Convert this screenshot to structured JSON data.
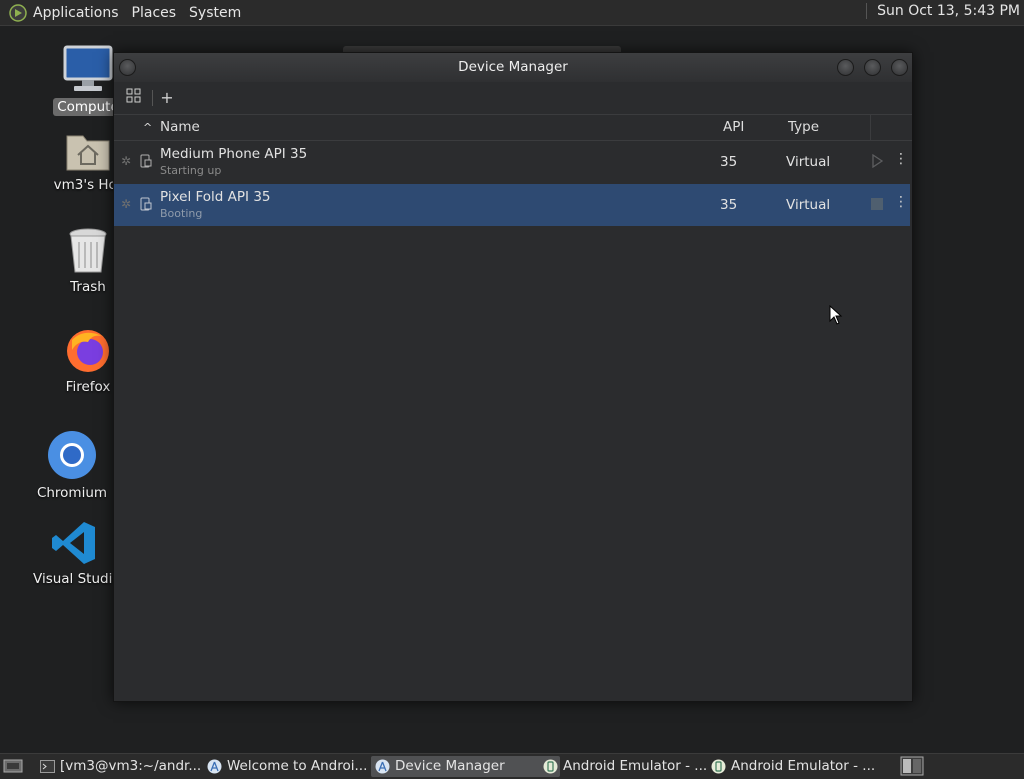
{
  "top_panel": {
    "menus": [
      "Applications",
      "Places",
      "System"
    ],
    "clock": "Sun Oct 13,  5:43 PM"
  },
  "desktop": {
    "icons": [
      {
        "label": "Compute",
        "icon": "computer-icon"
      },
      {
        "label": "vm3's Hor",
        "icon": "home-folder-icon"
      },
      {
        "label": "Trash",
        "icon": "trash-icon"
      },
      {
        "label": "Firefox",
        "icon": "firefox-icon"
      },
      {
        "label": "Chromium",
        "icon": "chromium-icon"
      },
      {
        "label": "Visual Studio Cc",
        "icon": "vscode-icon"
      }
    ]
  },
  "window": {
    "title": "Device Manager",
    "toolbar": {
      "add_label": "+"
    },
    "columns": {
      "name": "Name",
      "api": "API",
      "type": "Type"
    },
    "devices": [
      {
        "name": "Medium Phone API 35",
        "status": "Starting up",
        "api": "35",
        "type": "Virtual",
        "action": "play-icon",
        "selected": false
      },
      {
        "name": "Pixel Fold API 35",
        "status": "Booting",
        "api": "35",
        "type": "Virtual",
        "action": "stop-icon",
        "selected": true
      }
    ],
    "colors": {
      "selection": "#2e4a72",
      "background": "#2b2c2e"
    }
  },
  "taskbar": {
    "tasks": [
      {
        "label": "[vm3@vm3:~/andr...",
        "icon": "terminal-icon",
        "active": false
      },
      {
        "label": "Welcome to Androi...",
        "icon": "android-studio-icon",
        "active": false
      },
      {
        "label": "Device Manager",
        "icon": "android-studio-icon",
        "active": true
      },
      {
        "label": "Android Emulator - ...",
        "icon": "emulator-icon",
        "active": false
      },
      {
        "label": "Android Emulator - ...",
        "icon": "emulator-icon",
        "active": false
      }
    ]
  }
}
